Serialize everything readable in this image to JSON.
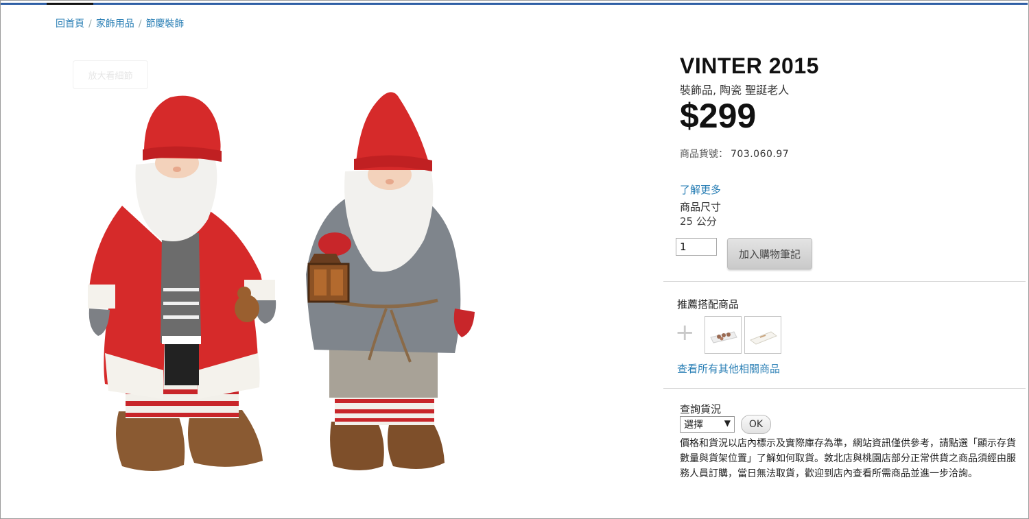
{
  "breadcrumb": {
    "items": [
      "回首頁",
      "家飾用品",
      "節慶裝飾"
    ],
    "separator": "/"
  },
  "ghost_button": {
    "label": "放大看細節"
  },
  "product": {
    "name": "VINTER 2015",
    "description": "裝飾品, 陶瓷 聖誕老人",
    "price": "$299",
    "article_label": "商品貨號：",
    "article_number": "703.060.97",
    "learn_more": "了解更多",
    "dimension_label": "商品尺寸",
    "dimension_value": "25 公分",
    "image_icon": "santa-figurines-image"
  },
  "cart": {
    "quantity": "1",
    "add_label": "加入購物筆記"
  },
  "recommendations": {
    "title": "推薦搭配商品",
    "plus": "+",
    "thumbs": [
      "tray-with-cones-thumb",
      "paper-napkin-thumb"
    ],
    "view_all": "查看所有其他相關商品"
  },
  "stock": {
    "title": "查詢貨況",
    "select_value": "選擇",
    "ok_label": "OK",
    "disclaimer": "價格和貨況以店內標示及實際庫存為準，網站資訊僅供參考，請點選「顯示存貨數量與貨架位置」了解如何取貨。敦北店與桃園店部分正常供貨之商品須經由服務人員訂購，當日無法取貨，歡迎到店內查看所需商品並進一步洽詢。"
  },
  "colors": {
    "link": "#2a7fb5",
    "topbar": "#2f5fa5"
  }
}
